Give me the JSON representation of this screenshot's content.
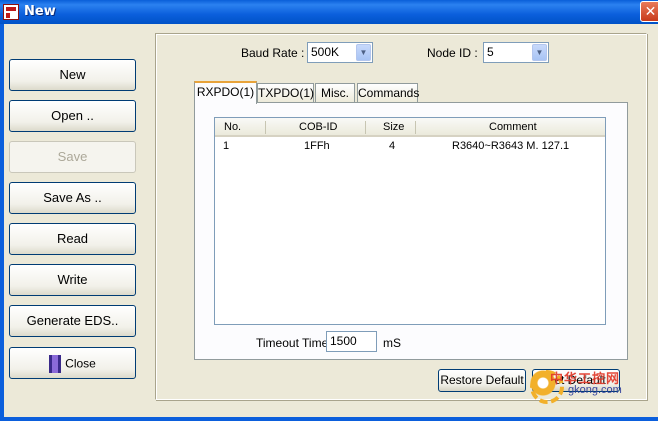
{
  "window": {
    "title": "New",
    "close_glyph": "✕"
  },
  "sidebar": {
    "new_label": "New",
    "open_label": "Open ..",
    "save_label": "Save",
    "save_as_label": "Save As ..",
    "read_label": "Read",
    "write_label": "Write",
    "generate_eds_label": "Generate EDS..",
    "close_label": "Close",
    "close_icon": "exit-door-icon"
  },
  "settings": {
    "baud_rate_label": "Baud Rate :",
    "baud_rate_value": "500K",
    "node_id_label": "Node ID :",
    "node_id_value": "5",
    "dropdown_glyph": "▼"
  },
  "tabs": [
    {
      "label": "RXPDO(1)",
      "active": true
    },
    {
      "label": "TXPDO(1)",
      "active": false
    },
    {
      "label": "Misc.",
      "active": false
    },
    {
      "label": "Commands",
      "active": false
    }
  ],
  "pdo_table": {
    "columns": [
      "No.",
      "COB-ID",
      "Size",
      "Comment"
    ],
    "rows": [
      {
        "no": "1",
        "cob_id": "1FFh",
        "size": "4",
        "comment": "R3640~R3643 M. 127.1"
      }
    ]
  },
  "timeout": {
    "label": "Timeout Time:",
    "value": "1500",
    "unit": "mS"
  },
  "footer": {
    "restore_default_label": "Restore Default",
    "set_default_label": "Set Default"
  },
  "watermark": {
    "text_cn": "中华工控网",
    "url": "gkong.com"
  },
  "colors": {
    "titlebar": "#0b5fdc",
    "active_tab_accent": "#e8a33a",
    "window_bg": "#ece9d8"
  }
}
